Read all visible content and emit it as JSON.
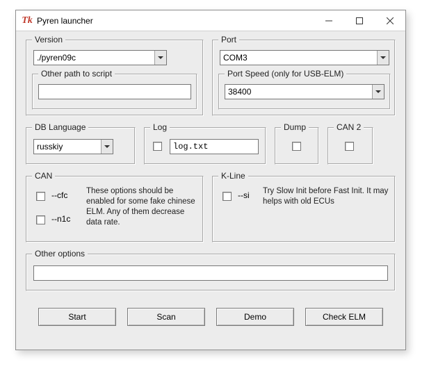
{
  "window": {
    "title": "Pyren launcher",
    "icon_glyph": "Tk"
  },
  "version": {
    "legend": "Version",
    "selected": "./pyren09c",
    "sub_legend": "Other path to script",
    "sub_value": ""
  },
  "port": {
    "legend": "Port",
    "selected": "COM3",
    "speed_legend": "Port Speed (only for USB-ELM)",
    "speed_selected": "38400"
  },
  "lang": {
    "legend": "DB Language",
    "selected": "russkiy"
  },
  "log": {
    "legend": "Log",
    "checked": false,
    "filename": "log.txt"
  },
  "dump": {
    "legend": "Dump",
    "checked": false
  },
  "can2": {
    "legend": "CAN 2",
    "checked": false
  },
  "can": {
    "legend": "CAN",
    "cfc_label": "--cfc",
    "cfc_checked": false,
    "n1c_label": "--n1c",
    "n1c_checked": false,
    "note": "These options should be enabled for some fake chinese ELM. Any of them decrease data rate."
  },
  "kline": {
    "legend": "K-Line",
    "si_label": "--si",
    "si_checked": false,
    "note": "Try Slow Init before Fast Init. It may helps with old ECUs"
  },
  "other": {
    "legend": "Other options",
    "value": ""
  },
  "buttons": {
    "start": "Start",
    "scan": "Scan",
    "demo": "Demo",
    "checkelm": "Check ELM"
  }
}
